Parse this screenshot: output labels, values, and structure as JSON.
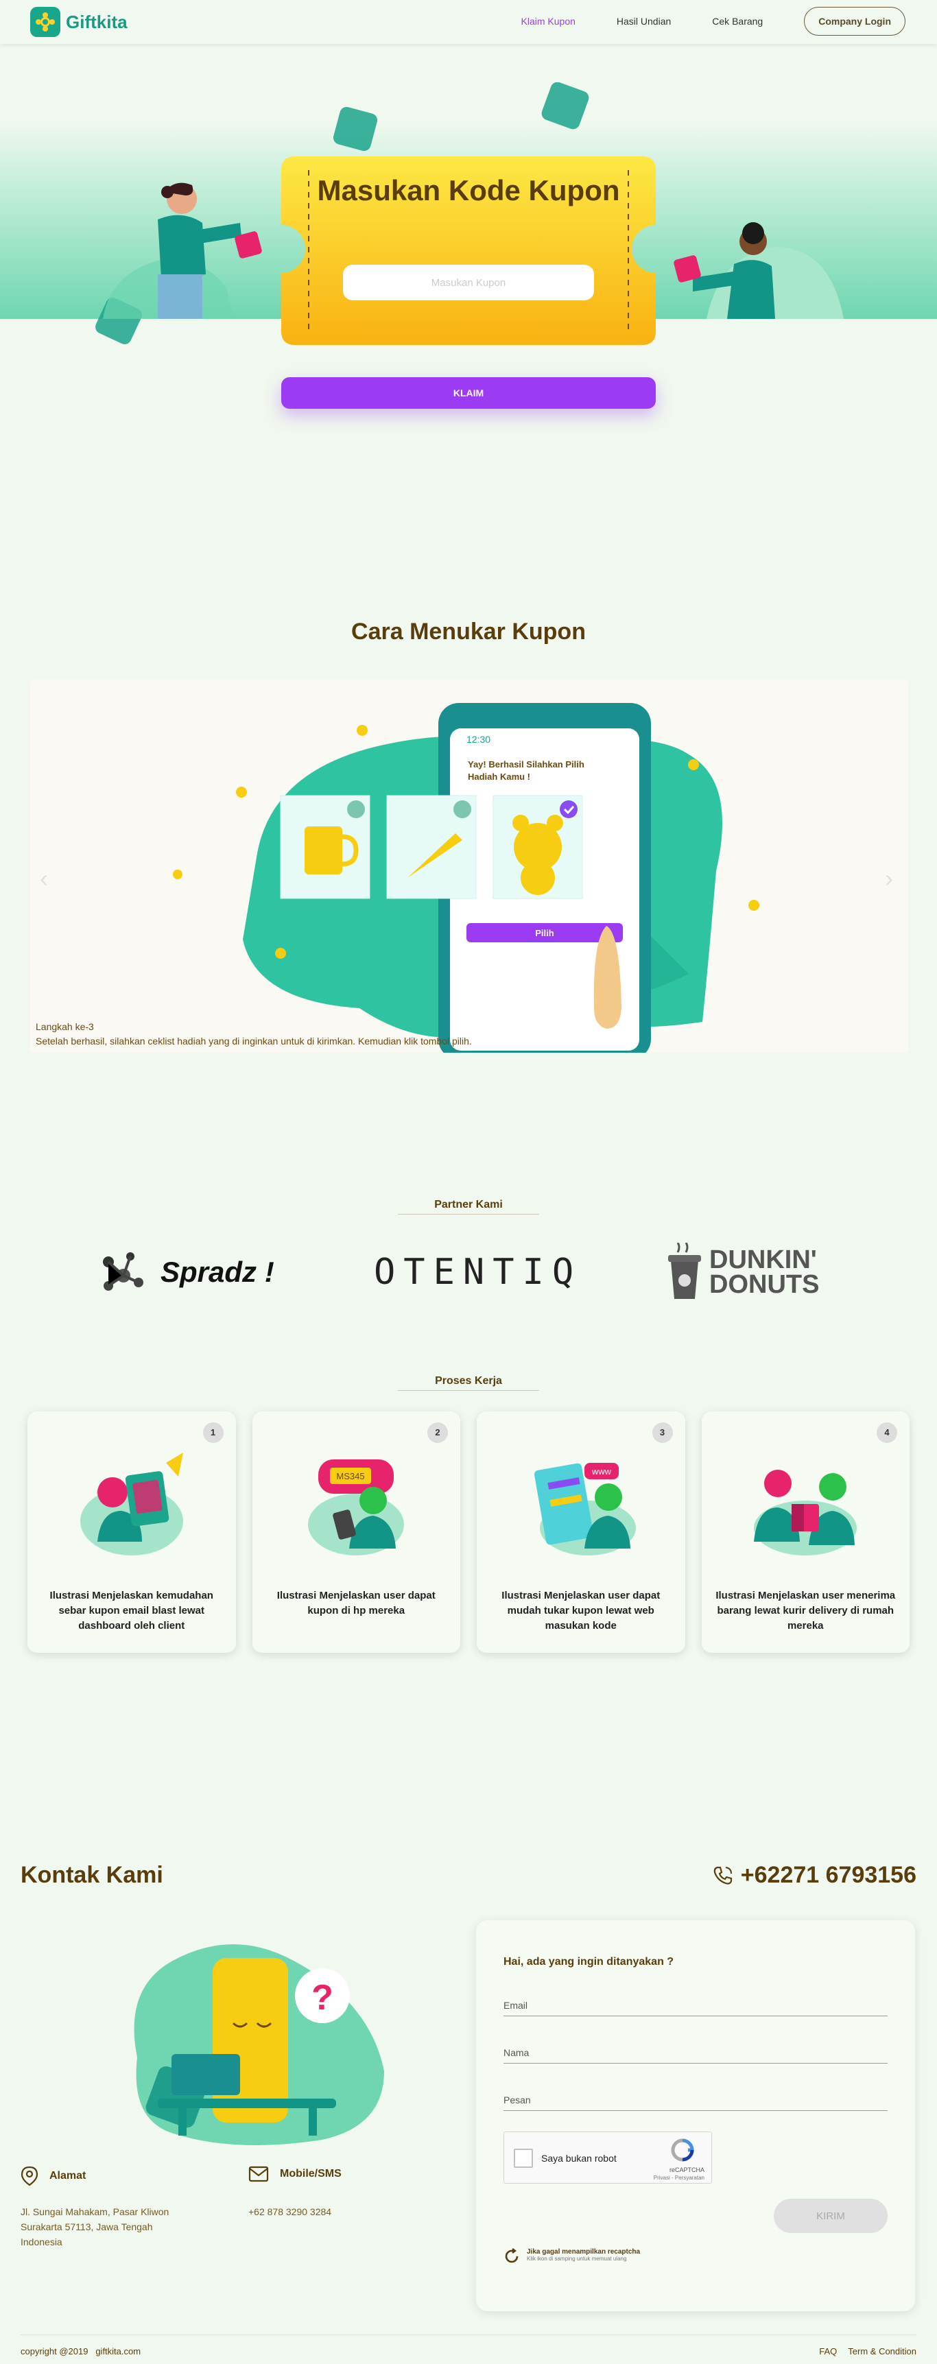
{
  "nav": {
    "brand": "Giftkita",
    "links": [
      "Klaim Kupon",
      "Hasil Undian",
      "Cek Barang"
    ],
    "login": "Company Login"
  },
  "hero": {
    "title": "Masukan Kode Kupon",
    "input_placeholder": "Masukan Kupon",
    "button": "KLAIM"
  },
  "cara": {
    "title": "Cara Menukar Kupon",
    "phone_time": "12:30",
    "phone_message": "Yay! Berhasil Silahkan Pilih Hadiah Kamu !",
    "phone_button": "Pilih",
    "step": "Langkah ke-3",
    "desc": "Setelah berhasil, silahkan ceklist hadiah yang di inginkan untuk di kirimkan. Kemudian klik tombol pilih."
  },
  "partner": {
    "title": "Partner Kami",
    "logos": [
      "Spradz !",
      "OTENTIQ",
      "DUNKIN'",
      "DONUTS"
    ]
  },
  "proses": {
    "title": "Proses Kerja",
    "cards": [
      {
        "num": "1",
        "text": "Ilustrasi Menjelaskan kemudahan sebar kupon email blast lewat dashboard oleh client"
      },
      {
        "num": "2",
        "text": "Ilustrasi Menjelaskan user dapat kupon di hp mereka",
        "badge": "MS345"
      },
      {
        "num": "3",
        "text": "Ilustrasi Menjelaskan user dapat mudah tukar kupon lewat web masukan kode",
        "badge": "www"
      },
      {
        "num": "4",
        "text": "Ilustrasi Menjelaskan user menerima barang lewat kurir delivery di rumah mereka"
      }
    ]
  },
  "kontak": {
    "title": "Kontak Kami",
    "phone": "+62271 6793156",
    "address_title": "Alamat",
    "address": [
      "Jl. Sungai Mahakam, Pasar Kliwon",
      "Surakarta 57113, Jawa Tengah",
      "Indonesia"
    ],
    "mobile_title": "Mobile/SMS",
    "mobile": "+62 878 3290 3284",
    "form_question": "Hai, ada yang ingin ditanyakan ?",
    "email_placeholder": "Email",
    "name_placeholder": "Nama",
    "message_placeholder": "Pesan",
    "captcha_label": "Saya bukan robot",
    "captcha_brand": "reCAPTCHA",
    "captcha_links": "Privasi - Persyaratan",
    "submit": "KIRIM",
    "reload_title": "Jika gagal menampilkan recaptcha",
    "reload_sub": "Klik ikon di samping untuk memuat ulang"
  },
  "footer": {
    "copyright": "copyright @2019",
    "site": "giftkita.com",
    "links": [
      "FAQ",
      "Term & Condition"
    ]
  },
  "colors": {
    "primary": "#9b3cf2",
    "teal": "#1a9a84",
    "brown": "#5a3d0c",
    "yellow": "#fbc21a"
  }
}
